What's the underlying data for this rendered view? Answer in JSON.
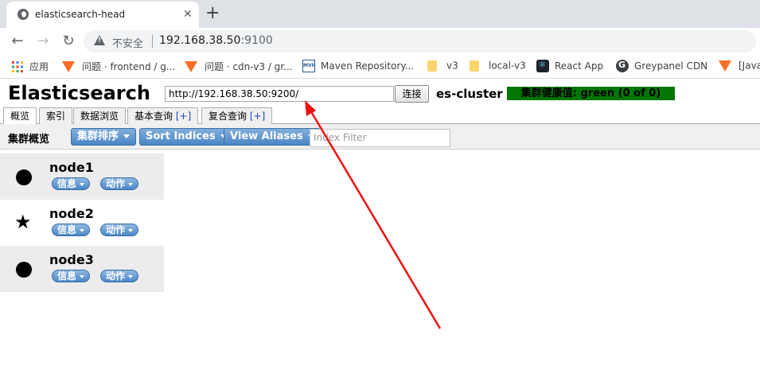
{
  "browser": {
    "tab_title": "elasticsearch-head",
    "tab_close": "✕",
    "new_tab": "+",
    "security_label": "不安全",
    "url_host": "192.168.38.50",
    "url_port": ":9100"
  },
  "bookmarks": [
    {
      "label": "应用",
      "icon": "apps-grid-icon"
    },
    {
      "label": "问题 · frontend / g...",
      "icon": "gitlab-icon"
    },
    {
      "label": "问题 · cdn-v3 / gr...",
      "icon": "gitlab-icon"
    },
    {
      "label": "Maven Repository...",
      "icon": "maven-icon"
    },
    {
      "label": "v3",
      "icon": "folder-icon"
    },
    {
      "label": "local-v3",
      "icon": "folder-icon"
    },
    {
      "label": "React App",
      "icon": "react-icon"
    },
    {
      "label": "Greypanel CDN",
      "icon": "g-icon"
    },
    {
      "label": "[Java",
      "icon": "gitlab-icon"
    }
  ],
  "app": {
    "title": "Elasticsearch",
    "connection_url": "http://192.168.38.50:9200/",
    "connect_button": "连接",
    "cluster_name": "es-cluster",
    "health": "集群健康值: green (0 of 0)",
    "health_color": "#007700",
    "tabs": [
      {
        "label": "概览",
        "plus": ""
      },
      {
        "label": "索引",
        "plus": ""
      },
      {
        "label": "数据浏览",
        "plus": ""
      },
      {
        "label": "基本查询 ",
        "plus": "[+]"
      },
      {
        "label": "复合查询 ",
        "plus": "[+]"
      }
    ],
    "overview": {
      "label": "集群概览",
      "sort_cluster": "集群排序",
      "sort_indices": "Sort Indices",
      "view_aliases": "View Aliases",
      "index_filter_placeholder": "Index Filter"
    },
    "nodes": [
      {
        "name": "node1",
        "role_icon": "circle-icon",
        "info": "信息",
        "actions": "动作"
      },
      {
        "name": "node2",
        "role_icon": "star-icon",
        "info": "信息",
        "actions": "动作"
      },
      {
        "name": "node3",
        "role_icon": "circle-icon",
        "info": "信息",
        "actions": "动作"
      }
    ]
  },
  "annotation": {
    "color": "#ee1111",
    "icon": "red-arrow-annotation"
  }
}
